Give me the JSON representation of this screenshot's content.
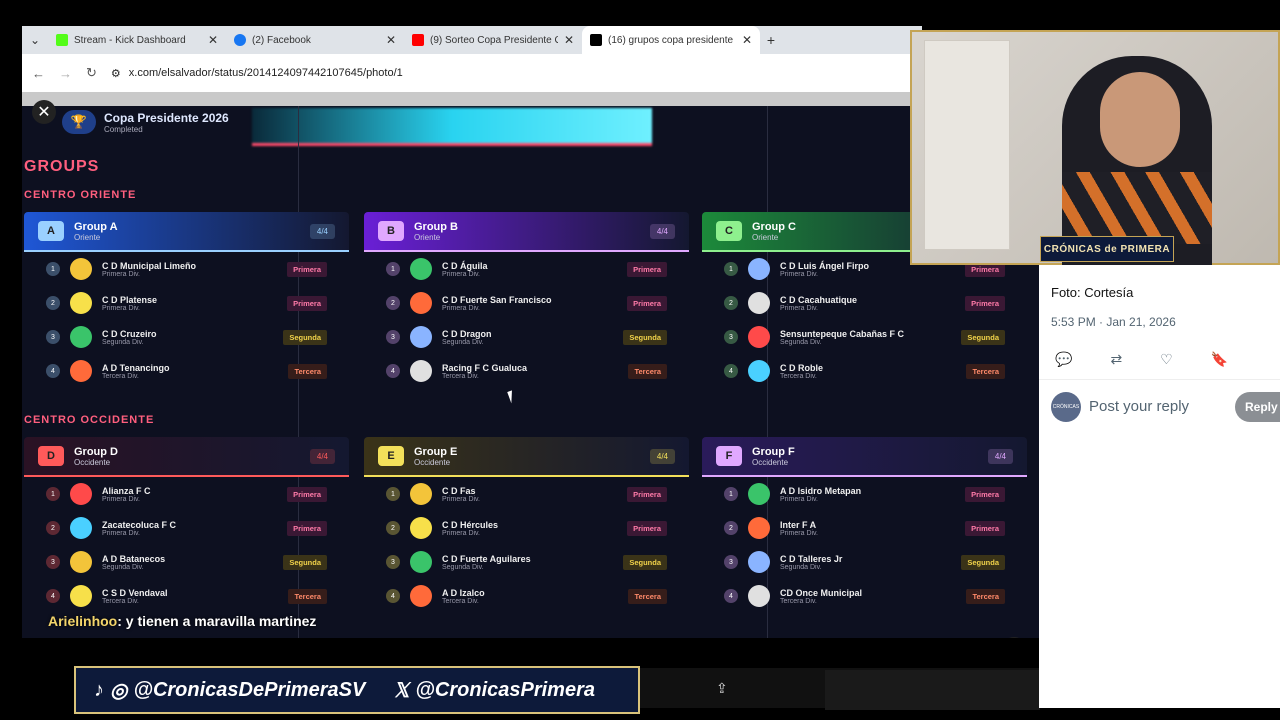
{
  "browser": {
    "tabs": [
      {
        "label": "Stream - Kick Dashboard",
        "color": "#53fc18"
      },
      {
        "label": "(2) Facebook",
        "color": "#1877f2"
      },
      {
        "label": "(9) Sorteo Copa Presidente Gar",
        "color": "#ff0000"
      },
      {
        "label": "(16) grupos copa presidente - S",
        "color": "#000000"
      }
    ],
    "url": "x.com/elsalvador/status/2014124097442107645/photo/1"
  },
  "viewer": {
    "title": "Copa Presidente 2026",
    "status": "Completed",
    "groups_heading": "GROUPS",
    "sections": [
      "CENTRO ORIENTE",
      "CENTRO OCCIDENTE"
    ],
    "groups": [
      {
        "letter": "A",
        "name": "Group A",
        "zone": "Oriente",
        "count": "4/4",
        "color": "#1f57d6",
        "badge": "#9ad0ff",
        "teams": [
          [
            "1",
            "C D Municipal Limeño",
            "Primera Div.",
            "Primera",
            "p"
          ],
          [
            "2",
            "C D Platense",
            "Primera Div.",
            "Primera",
            "p"
          ],
          [
            "3",
            "C D Cruzeiro",
            "Segunda Div.",
            "Segunda",
            "s"
          ],
          [
            "4",
            "A D Tenancingo",
            "Tercera Div.",
            "Tercera",
            "t"
          ]
        ]
      },
      {
        "letter": "B",
        "name": "Group B",
        "zone": "Oriente",
        "count": "4/4",
        "color": "#6a1fd6",
        "badge": "#e0a8ff",
        "teams": [
          [
            "1",
            "C D Águila",
            "Primera Div.",
            "Primera",
            "p"
          ],
          [
            "2",
            "C D Fuerte San Francisco",
            "Primera Div.",
            "Primera",
            "p"
          ],
          [
            "3",
            "C D Dragon",
            "Segunda Div.",
            "Segunda",
            "s"
          ],
          [
            "4",
            "Racing F C Gualuca",
            "Tercera Div.",
            "Tercera",
            "t"
          ]
        ]
      },
      {
        "letter": "C",
        "name": "Group C",
        "zone": "Oriente",
        "count": "4/4",
        "color": "#1c8a3a",
        "badge": "#8ef08e",
        "teams": [
          [
            "1",
            "C D Luis Ángel Firpo",
            "Primera Div.",
            "Primera",
            "p"
          ],
          [
            "2",
            "C D Cacahuatique",
            "Primera Div.",
            "Primera",
            "p"
          ],
          [
            "3",
            "Sensuntepeque Cabañas F C",
            "Segunda Div.",
            "Segunda",
            "s"
          ],
          [
            "4",
            "C D Roble",
            "Tercera Div.",
            "Tercera",
            "t"
          ]
        ]
      },
      {
        "letter": "D",
        "name": "Group D",
        "zone": "Occidente",
        "count": "4/4",
        "color": "#2a1224",
        "badge": "#ff5a5a",
        "teams": [
          [
            "1",
            "Alianza F C",
            "Primera Div.",
            "Primera",
            "p"
          ],
          [
            "2",
            "Zacatecoluca F C",
            "Primera Div.",
            "Primera",
            "p"
          ],
          [
            "3",
            "A D Batanecos",
            "Segunda Div.",
            "Segunda",
            "s"
          ],
          [
            "4",
            "C S D Vendaval",
            "Tercera Div.",
            "Tercera",
            "t"
          ]
        ]
      },
      {
        "letter": "E",
        "name": "Group E",
        "zone": "Occidente",
        "count": "4/4",
        "color": "#3a3318",
        "badge": "#f3e05a",
        "teams": [
          [
            "1",
            "C D Fas",
            "Primera Div.",
            "Primera",
            "p"
          ],
          [
            "2",
            "C D Hércules",
            "Primera Div.",
            "Primera",
            "p"
          ],
          [
            "3",
            "C D Fuerte Aguilares",
            "Segunda Div.",
            "Segunda",
            "s"
          ],
          [
            "4",
            "A D Izalco",
            "Tercera Div.",
            "Tercera",
            "t"
          ]
        ]
      },
      {
        "letter": "F",
        "name": "Group F",
        "zone": "Occidente",
        "count": "4/4",
        "color": "#2a1b5a",
        "badge": "#e0a8ff",
        "teams": [
          [
            "1",
            "A D Isidro Metapan",
            "Primera Div.",
            "Primera",
            "p"
          ],
          [
            "2",
            "Inter F A",
            "Primera Div.",
            "Primera",
            "p"
          ],
          [
            "3",
            "C D Talleres Jr",
            "Segunda Div.",
            "Segunda",
            "s"
          ],
          [
            "4",
            "CD Once Municipal",
            "Tercera Div.",
            "Tercera",
            "t"
          ]
        ]
      }
    ]
  },
  "chat": {
    "user": "Arielinhoo",
    "message": ": y tienen a maravilla martinez"
  },
  "social": {
    "instagram": "@CronicasDePrimeraSV",
    "x": "@CronicasPrimera"
  },
  "webcam": {
    "label": "CRÓNICAS de PRIMERA"
  },
  "tweet": {
    "caption": "Foto: Cortesía",
    "date": "5:53 PM · Jan 21, 2026",
    "reply_placeholder": "Post your reply",
    "reply_button": "Reply",
    "avatar_text": "CRÓNICAS"
  }
}
